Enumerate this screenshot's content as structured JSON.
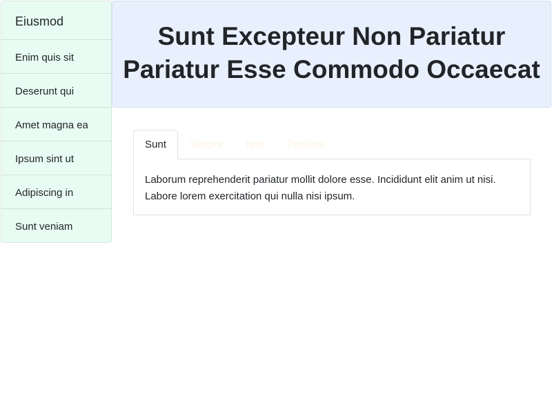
{
  "sidebar": {
    "title": "Eiusmod",
    "items": [
      {
        "label": "Enim quis sit"
      },
      {
        "label": "Deserunt qui"
      },
      {
        "label": "Amet magna ea"
      },
      {
        "label": "Ipsum sint ut"
      },
      {
        "label": "Adipiscing in"
      },
      {
        "label": "Sunt veniam"
      }
    ]
  },
  "header": {
    "title_line1": "Sunt Excepteur Non Pariatur",
    "title_line2": "Pariatur Esse Commodo Occaecat"
  },
  "tabs": [
    {
      "label": "Sunt",
      "active": true
    },
    {
      "label": "Tempor",
      "active": false
    },
    {
      "label": "Non",
      "active": false
    },
    {
      "label": "Proident",
      "active": false
    }
  ],
  "panel": {
    "text": "Laborum reprehenderit pariatur mollit dolore esse. Incididunt elit anim ut nisi. Labore lorem exercitation qui nulla nisi ipsum."
  },
  "colors": {
    "sidebar_bg": "#e9fcf3",
    "header_bg": "#e8f0fd",
    "inactive_tab_text": "#fdf3e2"
  }
}
